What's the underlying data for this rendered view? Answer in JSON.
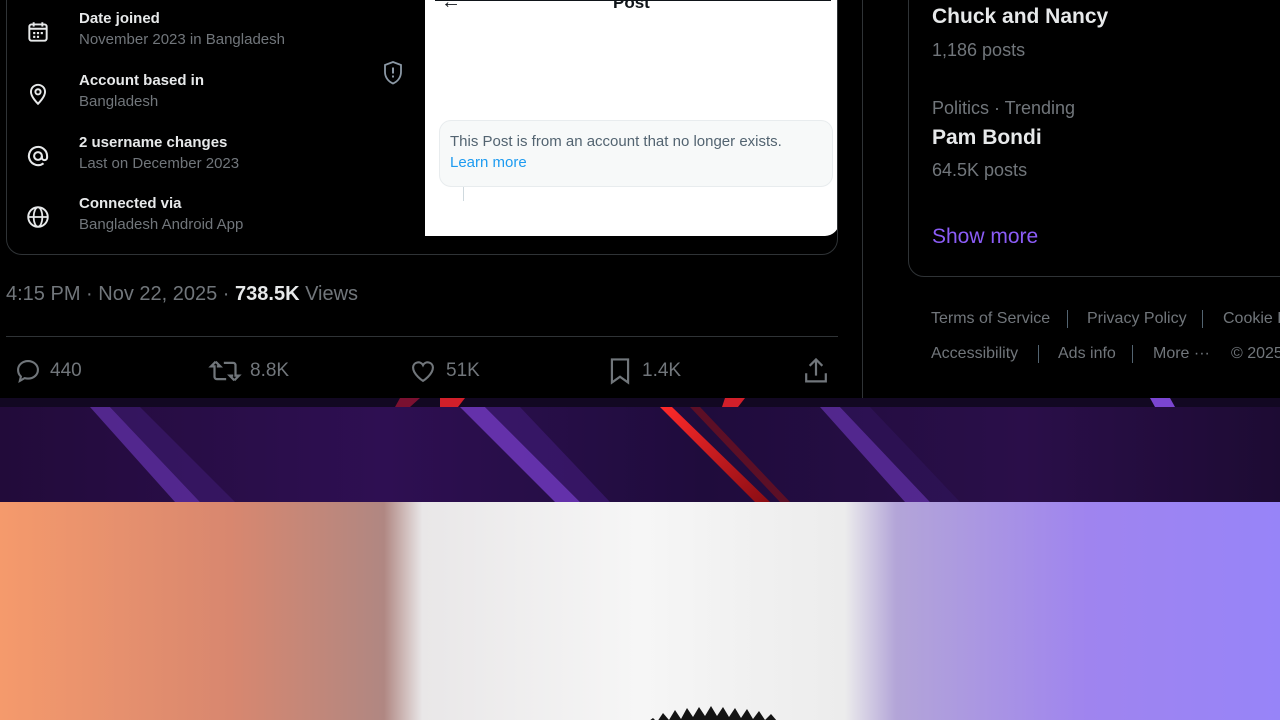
{
  "about": {
    "rows": [
      {
        "icon": "calendar-icon",
        "label": "Date joined",
        "value": "November 2023 in Bangladesh"
      },
      {
        "icon": "location-pin-icon",
        "label": "Account based in",
        "value": "Bangladesh"
      },
      {
        "icon": "at-sign-icon",
        "label": "2 username changes",
        "value": "Last on December 2023"
      },
      {
        "icon": "globe-icon",
        "label": "Connected via",
        "value": "Bangladesh Android App"
      }
    ]
  },
  "embed": {
    "title": "Post",
    "notice": "This Post is from an account that no longer exists.",
    "learn_more": "Learn more"
  },
  "post": {
    "timestamp": "4:15 PM · Nov 22, 2025 · ",
    "views_count": "738.5K",
    "views_label": " Views",
    "replies": "440",
    "reposts": "8.8K",
    "likes": "51K",
    "bookmarks": "1.4K"
  },
  "trends": [
    {
      "name": "Chuck and Nancy",
      "posts": "1,186 posts"
    },
    {
      "category": "Politics · Trending",
      "name": "Pam Bondi",
      "posts": "64.5K posts"
    }
  ],
  "show_more": "Show more",
  "footer": {
    "links": [
      "Terms of Service",
      "Privacy Policy",
      "Cookie Policy",
      "Accessibility",
      "Ads info",
      "More ···",
      "© 2025"
    ]
  },
  "colors": {
    "accent": "#8b5cf6",
    "link": "#1d9bf0",
    "muted": "#71767b"
  }
}
